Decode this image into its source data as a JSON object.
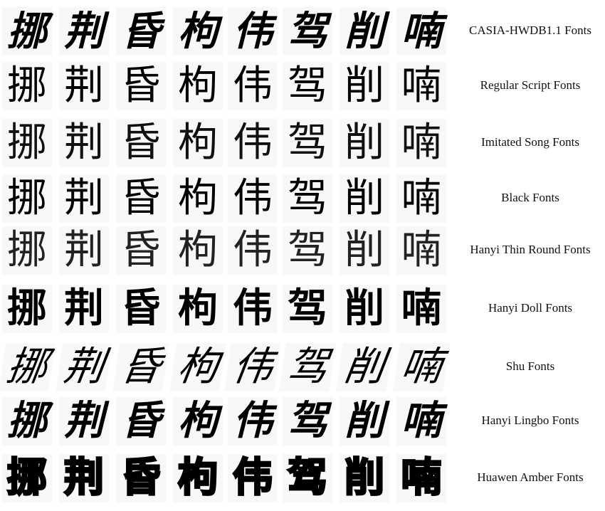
{
  "figure": {
    "characters": [
      "挪",
      "荆",
      "昏",
      "枸",
      "伟",
      "驾",
      "削",
      "喃"
    ],
    "rows": [
      {
        "label": "CASIA-HWDB1.1 Fonts"
      },
      {
        "label": "Regular Script Fonts"
      },
      {
        "label": "Imitated Song Fonts"
      },
      {
        "label": "Black Fonts"
      },
      {
        "label": "Hanyi Thin Round Fonts"
      },
      {
        "label": "Hanyi Doll Fonts"
      },
      {
        "label": "Shu Fonts"
      },
      {
        "label": "Hanyi Lingbo Fonts"
      },
      {
        "label": "Huawen Amber Fonts"
      }
    ]
  }
}
